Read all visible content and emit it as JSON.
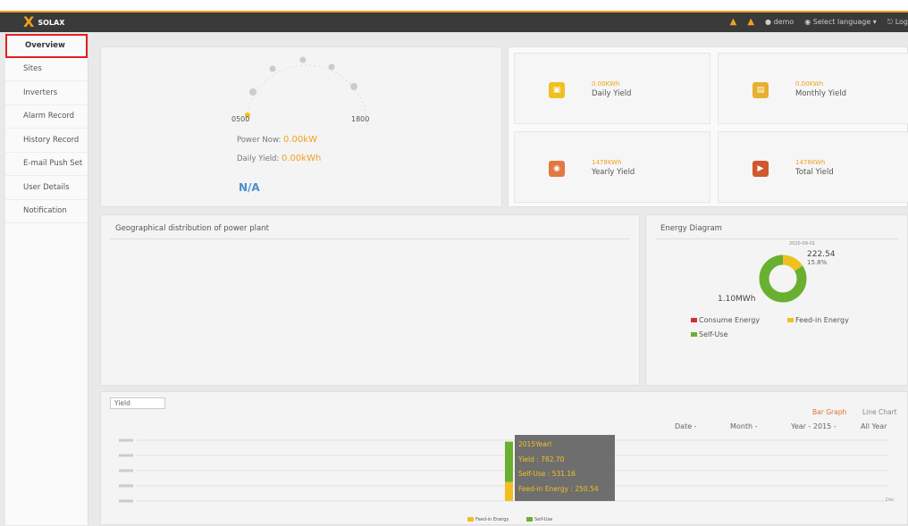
{
  "header": {
    "logo_mark": "X",
    "brand": "SOLAX",
    "user": "demo",
    "language": "Select language",
    "logout": "Log"
  },
  "sidebar": {
    "items": [
      {
        "label": "Overview",
        "active": true
      },
      {
        "label": "Sites"
      },
      {
        "label": "Inverters"
      },
      {
        "label": "Alarm Record"
      },
      {
        "label": "History Record"
      },
      {
        "label": "E-mail Push Set"
      },
      {
        "label": "User Details"
      },
      {
        "label": "Notification"
      }
    ]
  },
  "gauge": {
    "left_label": "0500",
    "right_label": "1800",
    "power_now_label": "Power Now:",
    "power_now_value": "0.00kW",
    "daily_yield_label": "Daily Yield:",
    "daily_yield_value": "0.00kWh",
    "status": "N/A"
  },
  "stats": [
    {
      "label": "Daily Yield",
      "value": "0.00KWh",
      "color": "#f0c020"
    },
    {
      "label": "Monthly Yield",
      "value": "0.00KWh",
      "color": "#e8b030"
    },
    {
      "label": "Yearly Yield",
      "value": "1478KWh",
      "color": "#e07840"
    },
    {
      "label": "Total Yield",
      "value": "1478KWh",
      "color": "#d05830"
    }
  ],
  "geo": {
    "title": "Geographical distribution of power plant"
  },
  "energy": {
    "title": "Energy Diagram",
    "top_label": "222.54",
    "top_small": "2020-09-01",
    "top_pct": "15.8%",
    "left_label": "1.10MWh",
    "legend": [
      {
        "label": "Consume Energy",
        "color": "#d03030"
      },
      {
        "label": "Feed-in Energy",
        "color": "#f0c020"
      },
      {
        "label": "Self-Use",
        "color": "#6ab030"
      }
    ],
    "slices": [
      {
        "name": "Feed-in Energy",
        "value": 15.8,
        "color": "#f0c020"
      },
      {
        "name": "Self-Use",
        "value": 84.2,
        "color": "#6ab030"
      }
    ]
  },
  "chart": {
    "select": "Yield",
    "bar_btn": "Bar Graph",
    "line_btn": "Line Chart",
    "filters": [
      "Date -",
      "Month -",
      "Year - 2015 -",
      "All Year"
    ],
    "tooltip": {
      "title": "2015Yearl",
      "yield": "Yield : 782.70",
      "self": "Self-Use : 531.16",
      "feed": "Feed-in Energy : 250.54"
    },
    "legend": [
      "Feed-in Energy",
      "Self-Use"
    ],
    "x_right": "Dec"
  },
  "chart_data": {
    "type": "bar",
    "categories": [
      "2015"
    ],
    "series": [
      {
        "name": "Self-Use",
        "values": [
          531.16
        ]
      },
      {
        "name": "Feed-in Energy",
        "values": [
          250.54
        ]
      }
    ]
  }
}
